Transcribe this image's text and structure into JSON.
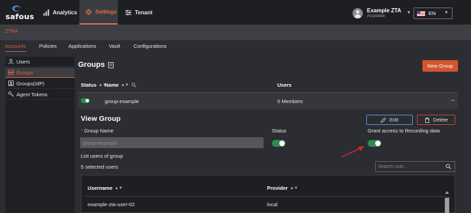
{
  "brand": {
    "name": "safous"
  },
  "nav": {
    "items": [
      {
        "label": "Analytics",
        "icon": "chart-icon"
      },
      {
        "label": "Settings",
        "icon": "gear-icon"
      },
      {
        "label": "Tenant",
        "icon": "sliders-icon"
      }
    ],
    "active": "Settings",
    "accent_color": "#d8603f"
  },
  "user": {
    "name": "Example ZTA",
    "status": "Available"
  },
  "language": {
    "label": "EN",
    "flag": "us-flag-icon"
  },
  "section": {
    "label": "ZTNA"
  },
  "subtabs": [
    "Accounts",
    "Policies",
    "Applications",
    "Vault",
    "Configurations"
  ],
  "sidebar": {
    "items": [
      {
        "label": "Users",
        "icon": "user-icon"
      },
      {
        "label": "Groups",
        "icon": "group-icon"
      },
      {
        "label": "Groups(IdP)",
        "icon": "group-idp-icon"
      },
      {
        "label": "Agent Tokens",
        "icon": "token-icon"
      }
    ],
    "active": "Groups"
  },
  "page": {
    "title": "Groups",
    "new_button": "New Group"
  },
  "table": {
    "headers": {
      "status": "Status",
      "name": "Name",
      "users": "Users"
    },
    "rows": [
      {
        "status_on": true,
        "name": "group-example",
        "users": "5 Members"
      }
    ]
  },
  "view_group": {
    "title": "View Group",
    "edit_label": "Edit",
    "delete_label": "Delete",
    "group_name_label": "Group Name",
    "group_name_value": "group-example",
    "status_label": "Status",
    "status_on": true,
    "recording_label": "Grant access to Recording data",
    "recording_on": true,
    "list_users_label": "List users of group",
    "selected_count_label": "5 selected users",
    "search_placeholder": "Search user...",
    "user_table": {
      "headers": {
        "username": "Username",
        "provider": "Provider"
      },
      "rows": [
        {
          "username": "example-zta-user-02",
          "provider": "local"
        }
      ]
    }
  },
  "colors": {
    "toggle_on": "#2f8a4e",
    "danger": "#d3542d",
    "edit_border": "#5a8fd6"
  }
}
